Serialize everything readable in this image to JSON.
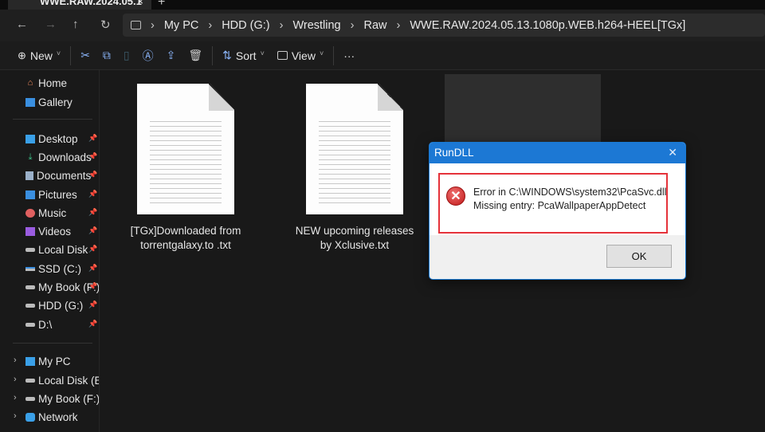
{
  "tab": {
    "title": "WWE.RAW.2024.05.1",
    "close": "×",
    "new_tab": "+"
  },
  "nav": {
    "back": "←",
    "forward": "→",
    "up": "↑",
    "refresh": "↻"
  },
  "breadcrumb": [
    "My PC",
    "HDD (G:)",
    "Wrestling",
    "Raw",
    "WWE.RAW.2024.05.13.1080p.WEB.h264-HEEL[TGx]"
  ],
  "toolbar": {
    "new": "New",
    "sort": "Sort",
    "view": "View",
    "more": "···"
  },
  "sidebar": {
    "top": [
      {
        "label": "Home",
        "icon": "home-icon"
      },
      {
        "label": "Gallery",
        "icon": "gallery-icon"
      }
    ],
    "pinned": [
      {
        "label": "Desktop",
        "icon": "desktop-icon"
      },
      {
        "label": "Downloads",
        "icon": "download-icon"
      },
      {
        "label": "Documents",
        "icon": "documents-icon"
      },
      {
        "label": "Pictures",
        "icon": "pictures-icon"
      },
      {
        "label": "Music",
        "icon": "music-icon"
      },
      {
        "label": "Videos",
        "icon": "videos-icon"
      },
      {
        "label": "Local Disk",
        "icon": "drive-icon"
      },
      {
        "label": "SSD (C:)",
        "icon": "drive-icon"
      },
      {
        "label": "My Book (F:)",
        "icon": "drive-icon"
      },
      {
        "label": " HDD (G:)",
        "icon": "drive-icon"
      },
      {
        "label": "D:\\",
        "icon": "drive-icon"
      }
    ],
    "tree": [
      {
        "label": "My PC",
        "icon": "pc-icon"
      },
      {
        "label": "Local Disk (E:)",
        "icon": "drive-icon"
      },
      {
        "label": "My Book (F:)",
        "icon": "drive-icon"
      },
      {
        "label": "Network",
        "icon": "network-icon"
      }
    ]
  },
  "files": [
    {
      "name": "[TGx]Downloaded from torrentgalaxy.to .txt"
    },
    {
      "name": "NEW upcoming releases by Xclusive.txt"
    }
  ],
  "dialog": {
    "title": "RunDLL",
    "close": "✕",
    "line1": "Error in C:\\WINDOWS\\system32\\PcaSvc.dll",
    "line2": "Missing entry: PcaWallpaperAppDetect",
    "ok": "OK"
  }
}
